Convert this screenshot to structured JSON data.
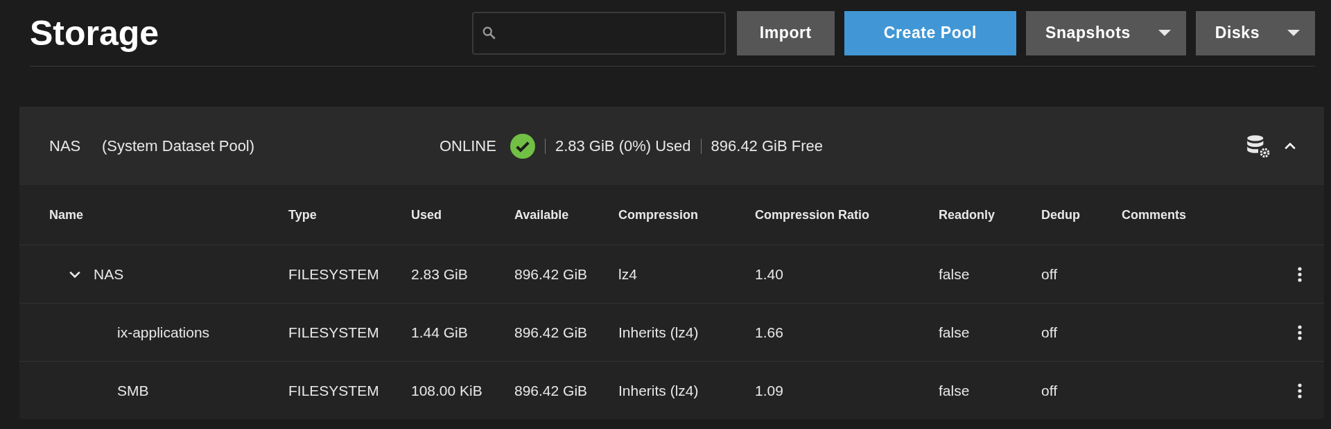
{
  "page_title": "Storage",
  "toolbar": {
    "buttons": [
      {
        "label": "Import",
        "kind": "plain"
      },
      {
        "label": "Create Pool",
        "kind": "primary"
      },
      {
        "label": "Snapshots",
        "kind": "dropdown"
      },
      {
        "label": "Disks",
        "kind": "dropdown"
      }
    ]
  },
  "pool": {
    "name": "NAS",
    "subtitle": "(System Dataset Pool)",
    "status": "ONLINE",
    "healthy": true,
    "used": "2.83 GiB (0%) Used",
    "free": "896.42 GiB Free",
    "expanded": true,
    "table": {
      "columns": [
        "Name",
        "Type",
        "Used",
        "Available",
        "Compression",
        "Compression Ratio",
        "Readonly",
        "Dedup",
        "Comments"
      ],
      "rows": [
        {
          "cells": [
            "NAS",
            "FILESYSTEM",
            "2.83 GiB",
            "896.42 GiB",
            "lz4",
            "1.40",
            "false",
            "off"
          ],
          "expanded": true,
          "children": [
            {
              "cells": [
                "ix-applications",
                "FILESYSTEM",
                "1.44 GiB",
                "896.42 GiB",
                "Inherits (lz4)",
                "1.66",
                "false",
                "off"
              ]
            },
            {
              "cells": [
                "SMB",
                "FILESYSTEM",
                "108.00 KiB",
                "896.42 GiB",
                "Inherits (lz4)",
                "1.09",
                "false",
                "off"
              ]
            }
          ]
        }
      ]
    }
  }
}
